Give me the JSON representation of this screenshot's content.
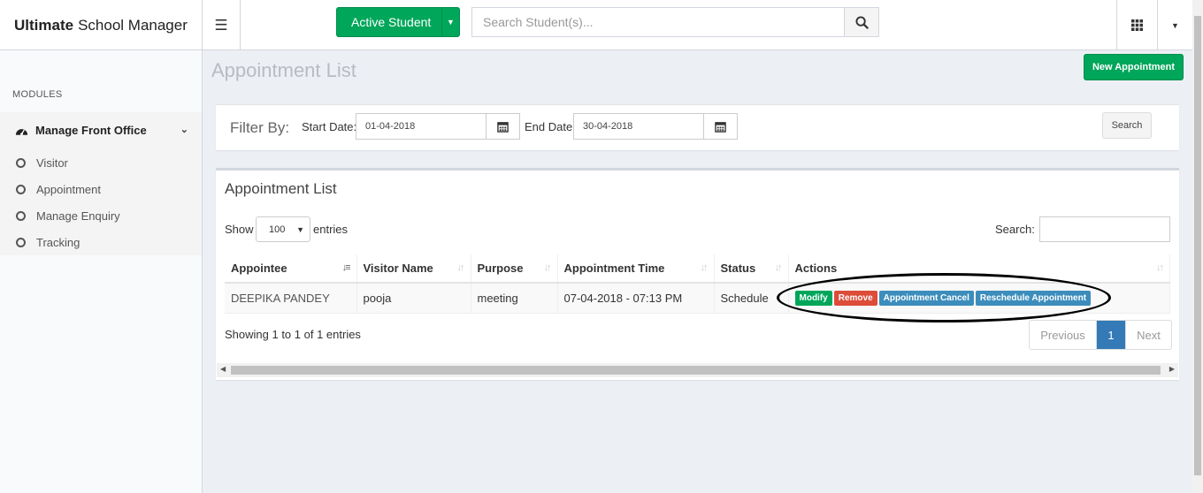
{
  "brand": {
    "bold": "Ultimate",
    "rest": "School Manager"
  },
  "header": {
    "active_student_label": "Active Student",
    "search_placeholder": "Search Student(s)..."
  },
  "sidebar": {
    "section_label": "MODULES",
    "group_label": "Manage Front Office",
    "items": [
      {
        "label": "Visitor"
      },
      {
        "label": "Appointment"
      },
      {
        "label": "Manage Enquiry"
      },
      {
        "label": "Tracking"
      }
    ]
  },
  "page": {
    "title": "Appointment List",
    "new_button": "New Appointment"
  },
  "filter": {
    "label": "Filter By:",
    "start_label": "Start Date:",
    "start_value": "01-04-2018",
    "end_label": "End Date:",
    "end_value": "30-04-2018",
    "search_button": "Search"
  },
  "list": {
    "title": "Appointment List",
    "show_label": "Show",
    "entries_value": "100",
    "entries_label": "entries",
    "search_label": "Search:",
    "columns": [
      "Appointee",
      "Visitor Name",
      "Purpose",
      "Appointment Time",
      "Status",
      "Actions"
    ],
    "rows": [
      {
        "appointee": "DEEPIKA PANDEY",
        "visitor": "pooja",
        "purpose": "meeting",
        "time": "07-04-2018 - 07:13 PM",
        "status": "Schedule",
        "actions": [
          "Modify",
          "Remove",
          "Appointment Cancel",
          "Reschedule Appointment"
        ]
      }
    ],
    "info": "Showing 1 to 1 of 1 entries",
    "pager": {
      "prev": "Previous",
      "current": "1",
      "next": "Next"
    }
  },
  "colors": {
    "success": "#00a65a",
    "danger": "#dd4b39",
    "info": "#3c8dbc",
    "primary": "#337ab7"
  }
}
